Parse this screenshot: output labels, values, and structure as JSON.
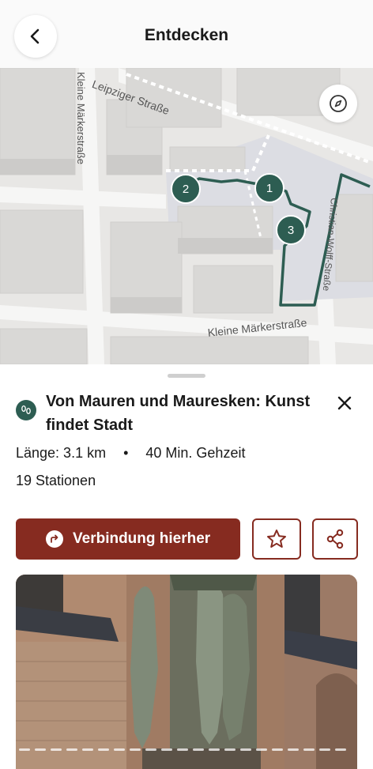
{
  "header": {
    "title": "Entdecken",
    "back_icon": "chevron-left-icon"
  },
  "map": {
    "compass_icon": "compass-icon",
    "streets": {
      "leipziger": "Leipziger Straße",
      "kleine_maerker_vertical": "Kleine Märkerstraße",
      "kleine_maerker_horizontal": "Kleine Märkerstraße",
      "christian_wolff": "Christian-Wolff-Straße"
    },
    "stations": [
      {
        "label": "1"
      },
      {
        "label": "2"
      },
      {
        "label": "3"
      }
    ],
    "route_color": "#2d5d52"
  },
  "route": {
    "icon": "footsteps-icon",
    "title": "Von Mauren und Mauresken: Kunst findet Stadt",
    "length": "Länge: 3.1 km",
    "separator": "•",
    "duration": "40 Min. Gehzeit",
    "stations": "19 Stationen"
  },
  "actions": {
    "connection_label": "Verbindung hierher",
    "connection_icon": "turn-right-arrow-icon",
    "favorite_icon": "star-icon",
    "share_icon": "share-icon",
    "close_icon": "close-icon"
  },
  "colors": {
    "accent": "#862b20",
    "route_green": "#2d5d52"
  }
}
